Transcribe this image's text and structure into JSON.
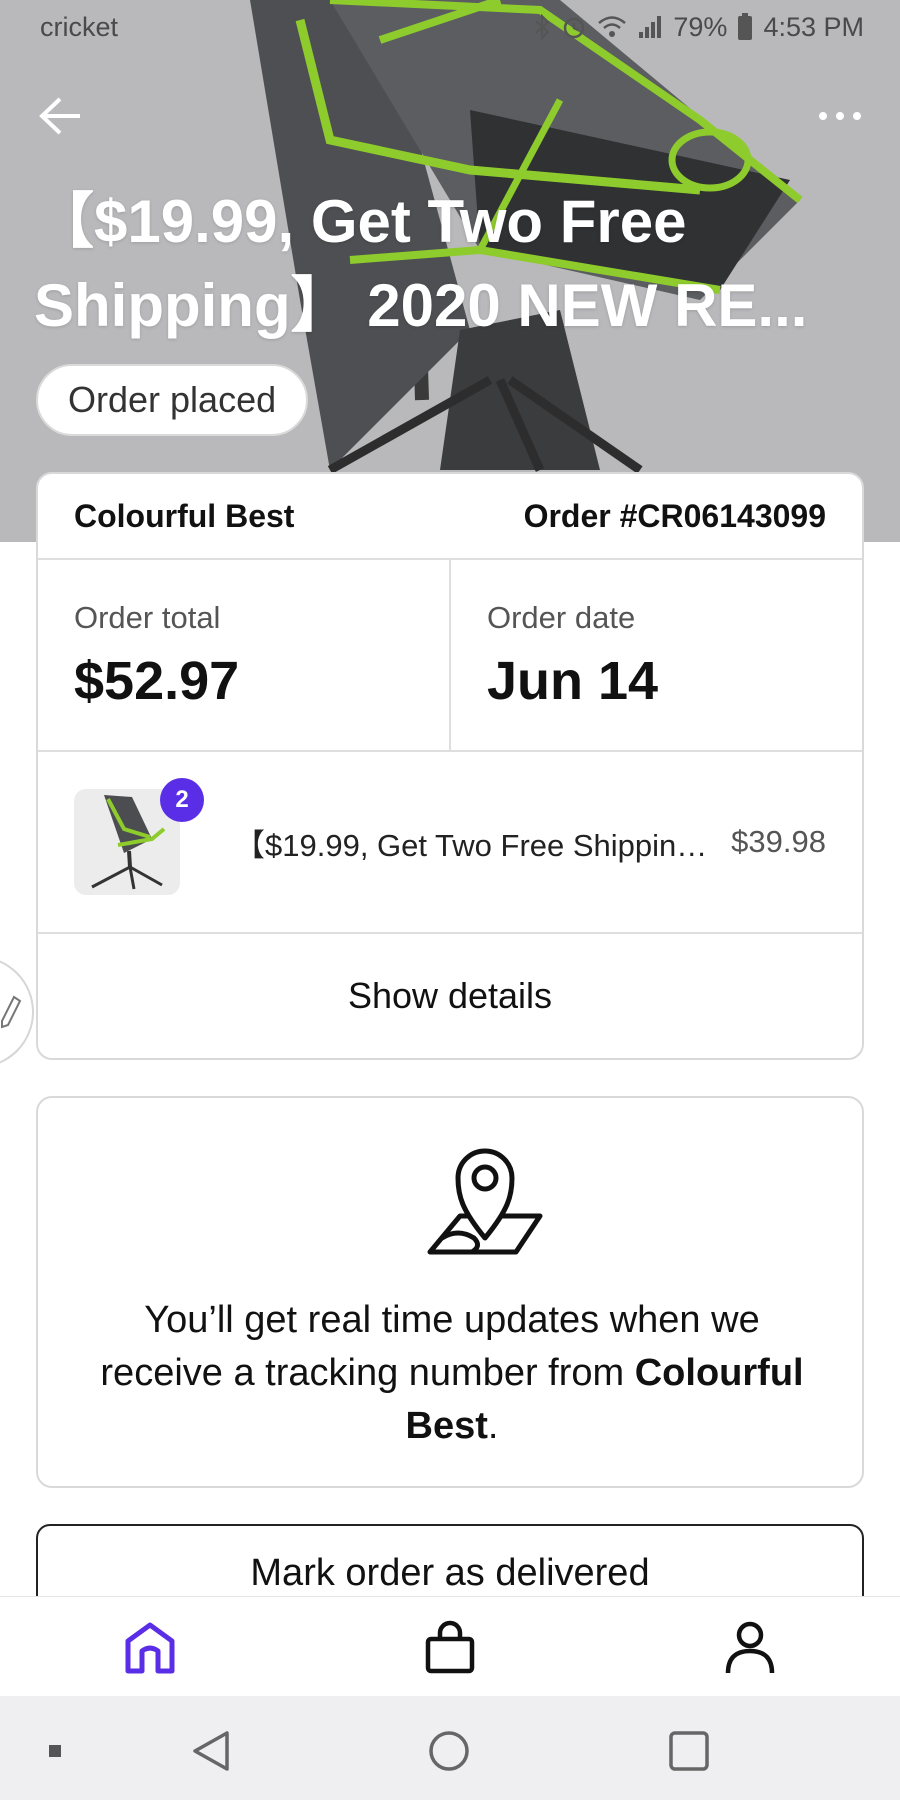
{
  "status_bar": {
    "carrier": "cricket",
    "battery": "79%",
    "time": "4:53 PM"
  },
  "hero": {
    "title_line1": "【$19.99, Get Two Free",
    "title_line2": "Shipping】 2020 NEW RE...",
    "status": "Order placed"
  },
  "order": {
    "store": "Colourful Best",
    "number": "Order #CR06143099",
    "total_label": "Order total",
    "total_value": "$52.97",
    "date_label": "Order date",
    "date_value": "Jun 14",
    "item": {
      "quantity": "2",
      "name": "【$19.99, Get Two Free Shipping】 2020 NEW RE",
      "price": "$39.98"
    },
    "show_details": "Show details"
  },
  "tracking": {
    "text_before": "You’ll get real time updates when we receive a tracking number from ",
    "store": "Colourful Best",
    "text_after": "."
  },
  "actions": {
    "mark_delivered": "Mark order as delivered"
  },
  "nav": {
    "active": "home",
    "accent": "#5a2ee6",
    "items": [
      "home-icon",
      "bag-icon",
      "profile-icon"
    ]
  },
  "colors": {
    "accent": "#5a2ee6",
    "hero_bg": "#b9b9bb",
    "chair_green": "#8ecb2c"
  }
}
